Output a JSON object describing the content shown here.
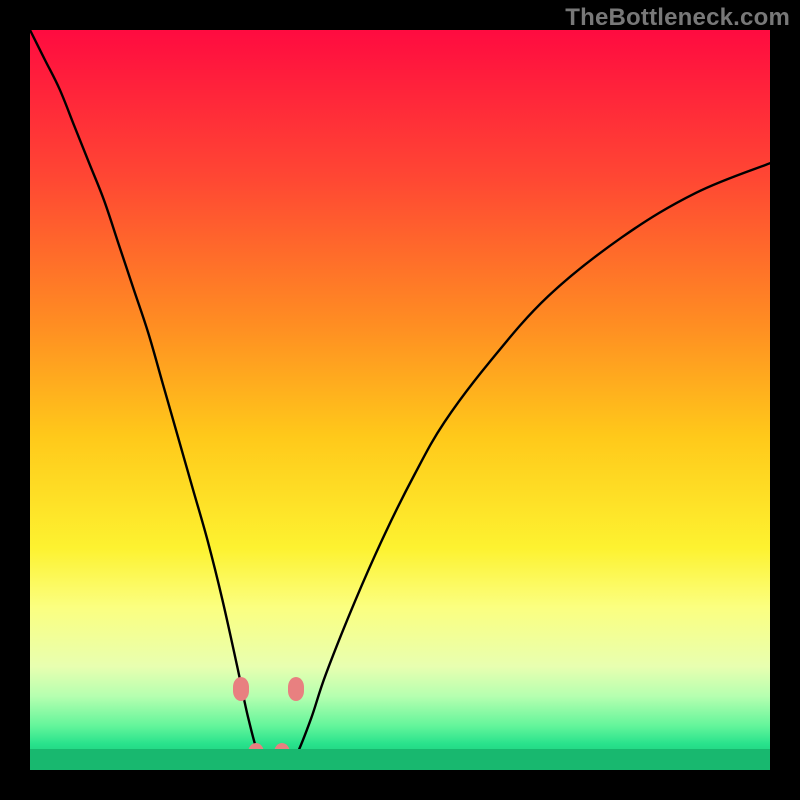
{
  "watermark": "TheBottleneck.com",
  "chart_data": {
    "type": "line",
    "title": "",
    "xlabel": "",
    "ylabel": "",
    "xlim": [
      0,
      100
    ],
    "ylim": [
      0,
      100
    ],
    "grid": false,
    "legend": false,
    "background": {
      "type": "vertical-gradient",
      "stops": [
        {
          "pos": 0.0,
          "color": "#ff0b40"
        },
        {
          "pos": 0.2,
          "color": "#ff4733"
        },
        {
          "pos": 0.4,
          "color": "#ff8e22"
        },
        {
          "pos": 0.55,
          "color": "#ffc91a"
        },
        {
          "pos": 0.7,
          "color": "#fdf230"
        },
        {
          "pos": 0.78,
          "color": "#fbff80"
        },
        {
          "pos": 0.86,
          "color": "#e8ffb0"
        },
        {
          "pos": 0.9,
          "color": "#b6ffb0"
        },
        {
          "pos": 0.94,
          "color": "#64f59b"
        },
        {
          "pos": 0.965,
          "color": "#28e28c"
        },
        {
          "pos": 1.0,
          "color": "#18b86f"
        }
      ]
    },
    "series": [
      {
        "name": "bottleneck-curve",
        "color": "#000000",
        "x": [
          0,
          2,
          4,
          6,
          8,
          10,
          12,
          14,
          16,
          18,
          20,
          22,
          24,
          26,
          28,
          29.5,
          31,
          33,
          34.5,
          36,
          38,
          40,
          44,
          48,
          52,
          56,
          62,
          70,
          80,
          90,
          100
        ],
        "y": [
          100,
          96,
          92,
          87,
          82,
          77,
          71,
          65,
          59,
          52,
          45,
          38,
          31,
          23,
          14,
          7,
          2,
          0,
          0,
          2,
          7,
          13,
          23,
          32,
          40,
          47,
          55,
          64,
          72,
          78,
          82
        ]
      }
    ],
    "markers": [
      {
        "name": "left-shoulder",
        "x": 28.5,
        "y": 11,
        "color": "#e88080"
      },
      {
        "name": "left-bottom",
        "x": 30.5,
        "y": 2,
        "color": "#e88080"
      },
      {
        "name": "right-bottom",
        "x": 34.0,
        "y": 2,
        "color": "#e88080"
      },
      {
        "name": "right-shoulder",
        "x": 36.0,
        "y": 11,
        "color": "#e88080"
      }
    ],
    "bottom_bar": {
      "height_fraction": 0.028,
      "color": "#18b86f"
    }
  }
}
